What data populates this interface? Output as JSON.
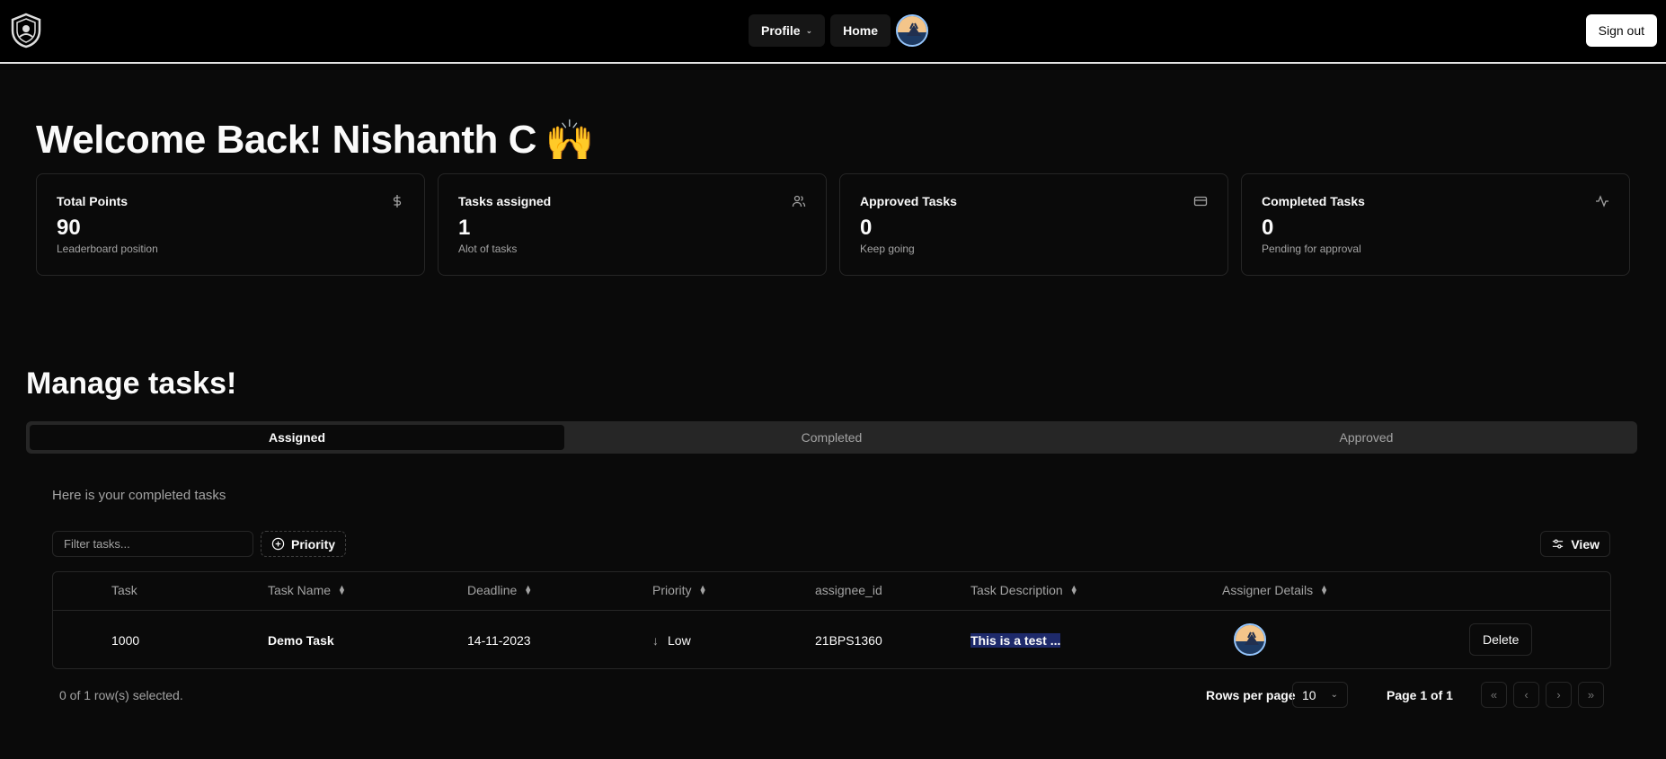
{
  "nav": {
    "profile_label": "Profile",
    "home_label": "Home",
    "signout_label": "Sign out"
  },
  "welcome": {
    "text": "Welcome Back! Nishanth C",
    "emoji": "🙌"
  },
  "stats": [
    {
      "title": "Total Points",
      "value": "90",
      "sub": "Leaderboard position",
      "icon": "dollar-icon"
    },
    {
      "title": "Tasks assigned",
      "value": "1",
      "sub": "Alot of tasks",
      "icon": "users-icon"
    },
    {
      "title": "Approved Tasks",
      "value": "0",
      "sub": "Keep going",
      "icon": "credit-card-icon"
    },
    {
      "title": "Completed Tasks",
      "value": "0",
      "sub": "Pending for approval",
      "icon": "activity-icon"
    }
  ],
  "manage": {
    "title": "Manage tasks!",
    "tabs": [
      "Assigned",
      "Completed",
      "Approved"
    ],
    "active_tab": "Assigned",
    "subtitle": "Here is your completed tasks",
    "filter_placeholder": "Filter tasks...",
    "priority_label": "Priority",
    "view_label": "View"
  },
  "table": {
    "headers": [
      "Task",
      "Task Name",
      "Deadline",
      "Priority",
      "assignee_id",
      "Task Description",
      "Assigner Details"
    ],
    "rows": [
      {
        "task": "1000",
        "name": "Demo Task",
        "deadline": "14-11-2023",
        "priority": "Low",
        "assignee_id": "21BPS1360",
        "description": "This is a test ...",
        "action": "Delete"
      }
    ]
  },
  "footer": {
    "selected": "0 of 1 row(s) selected.",
    "rows_per_page_label": "Rows per page",
    "rows_per_page": "10",
    "page_info": "Page 1 of 1"
  }
}
